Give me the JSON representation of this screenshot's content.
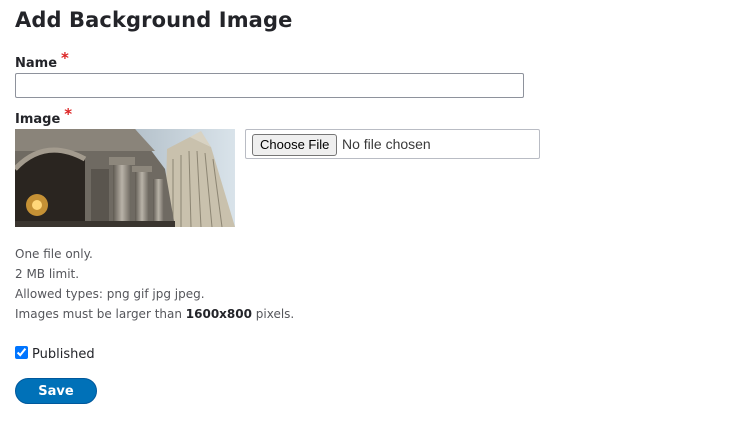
{
  "page": {
    "title": "Add Background Image"
  },
  "form": {
    "name": {
      "label": "Name",
      "required_marker": "*",
      "value": "",
      "placeholder": ""
    },
    "image": {
      "label": "Image",
      "required_marker": "*",
      "preview_icon": "building-photo",
      "choose_button": "Choose File",
      "status": "No file chosen"
    },
    "descriptions": {
      "line1": "One file only.",
      "line2": "2 MB limit.",
      "line3": "Allowed types: png gif jpg jpeg.",
      "line4_prefix": "Images must be larger than ",
      "line4_size": "1600x800",
      "line4_suffix": " pixels."
    },
    "published": {
      "label": "Published",
      "checked": true
    },
    "save_label": "Save"
  },
  "colors": {
    "accent": "#0071b8",
    "required": "#dc2323",
    "text": "#232429"
  }
}
